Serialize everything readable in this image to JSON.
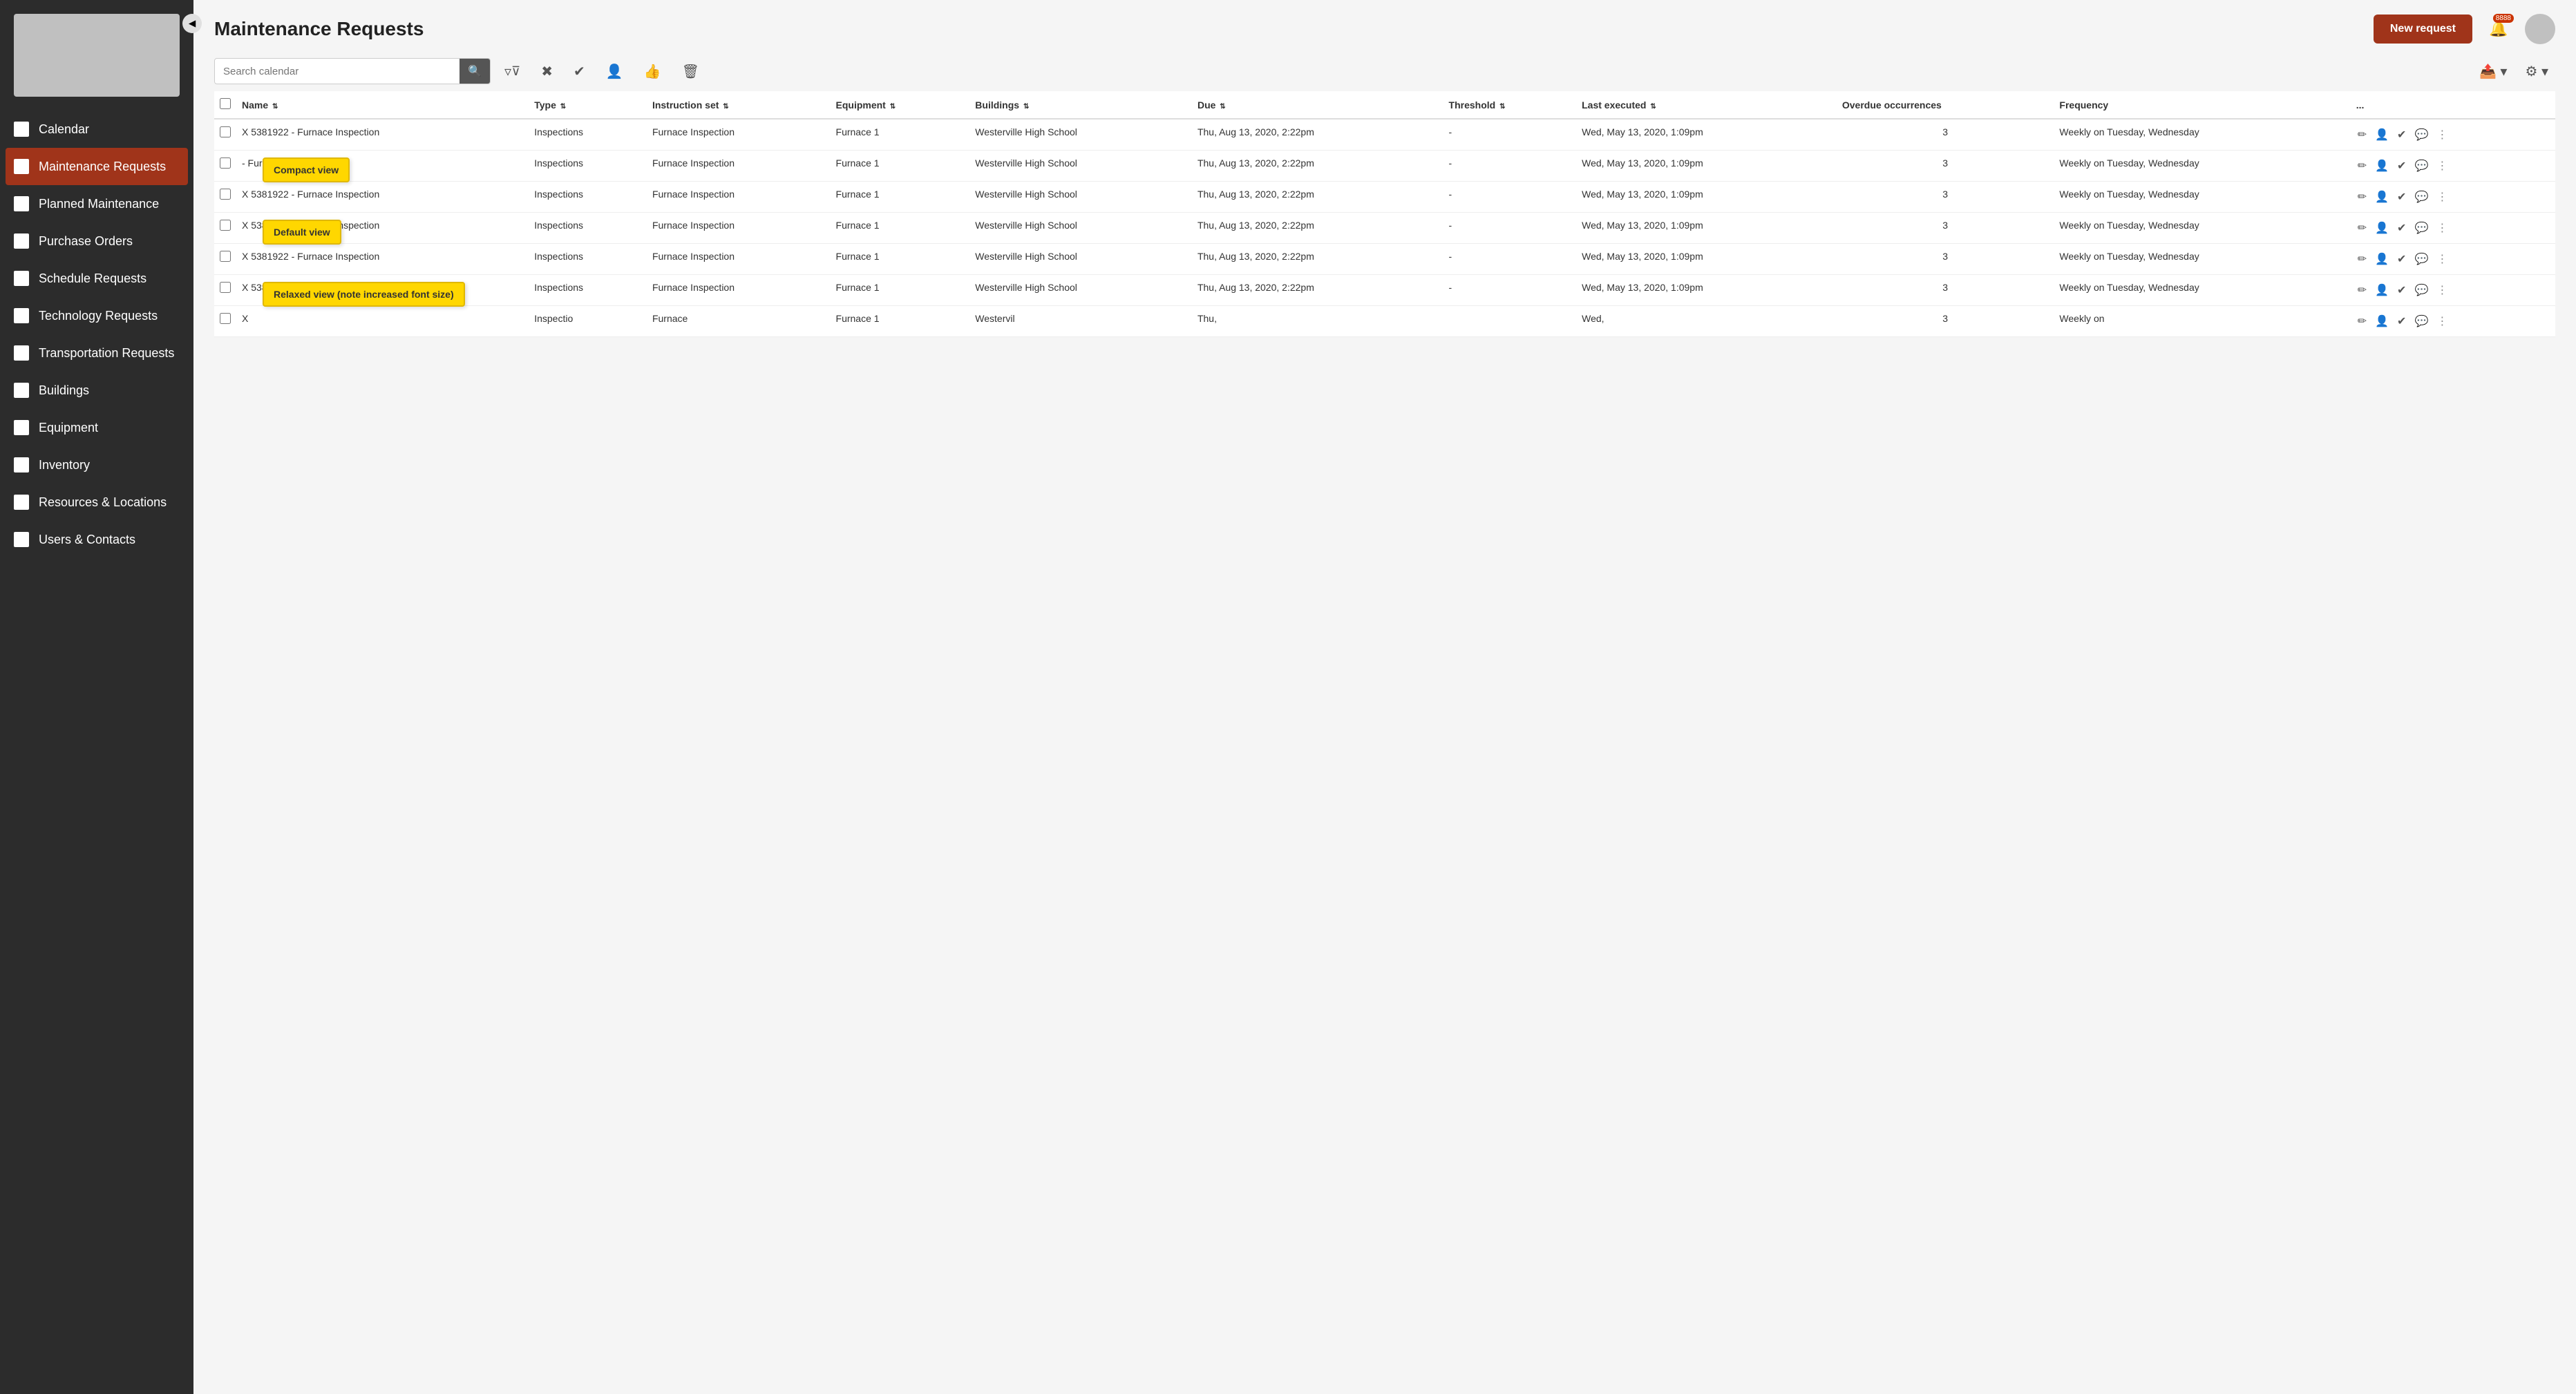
{
  "app": {
    "title": "Maintenance Requests",
    "new_request_label": "New request",
    "notification_count": "8888"
  },
  "sidebar": {
    "items": [
      {
        "id": "calendar",
        "label": "Calendar",
        "active": false
      },
      {
        "id": "maintenance-requests",
        "label": "Maintenance Requests",
        "active": true
      },
      {
        "id": "planned-maintenance",
        "label": "Planned Maintenance",
        "active": false
      },
      {
        "id": "purchase-orders",
        "label": "Purchase Orders",
        "active": false
      },
      {
        "id": "schedule-requests",
        "label": "Schedule Requests",
        "active": false
      },
      {
        "id": "technology-requests",
        "label": "Technology Requests",
        "active": false
      },
      {
        "id": "transportation-requests",
        "label": "Transportation Requests",
        "active": false
      },
      {
        "id": "buildings",
        "label": "Buildings",
        "active": false
      },
      {
        "id": "equipment",
        "label": "Equipment",
        "active": false
      },
      {
        "id": "inventory",
        "label": "Inventory",
        "active": false
      },
      {
        "id": "resources-locations",
        "label": "Resources & Locations",
        "active": false
      },
      {
        "id": "users-contacts",
        "label": "Users & Contacts",
        "active": false
      }
    ]
  },
  "toolbar": {
    "search_placeholder": "Search calendar"
  },
  "table": {
    "columns": [
      {
        "id": "name",
        "label": "Name"
      },
      {
        "id": "type",
        "label": "Type"
      },
      {
        "id": "instruction-set",
        "label": "Instruction set"
      },
      {
        "id": "equipment",
        "label": "Equipment"
      },
      {
        "id": "buildings",
        "label": "Buildings"
      },
      {
        "id": "due",
        "label": "Due"
      },
      {
        "id": "threshold",
        "label": "Threshold"
      },
      {
        "id": "last-executed",
        "label": "Last executed"
      },
      {
        "id": "overdue-occurrences",
        "label": "Overdue occurrences"
      },
      {
        "id": "frequency",
        "label": "Frequency"
      },
      {
        "id": "more",
        "label": "..."
      }
    ],
    "rows": [
      {
        "name": "X 5381922 - Furnace Inspection",
        "type": "Inspections",
        "instruction_set": "Furnace Inspection",
        "equipment": "Furnace 1",
        "buildings": "Westerville High School",
        "due": "Thu, Aug 13, 2020, 2:22pm",
        "threshold": "-",
        "last_executed": "Wed, May 13, 2020, 1:09pm",
        "overdue_occurrences": "3",
        "frequency": "Weekly on Tuesday, Wednesday",
        "tooltip": null
      },
      {
        "name": "- Furnace Inspection",
        "type": "Inspections",
        "instruction_set": "Furnace Inspection",
        "equipment": "Furnace 1",
        "buildings": "Westerville High School",
        "due": "Thu, Aug 13, 2020, 2:22pm",
        "threshold": "-",
        "last_executed": "Wed, May 13, 2020, 1:09pm",
        "overdue_occurrences": "3",
        "frequency": "Weekly on Tuesday, Wednesday",
        "tooltip": "Compact view"
      },
      {
        "name": "X 5381922 - Furnace Inspection",
        "type": "Inspections",
        "instruction_set": "Furnace Inspection",
        "equipment": "Furnace 1",
        "buildings": "Westerville High School",
        "due": "Thu, Aug 13, 2020, 2:22pm",
        "threshold": "-",
        "last_executed": "Wed, May 13, 2020, 1:09pm",
        "overdue_occurrences": "3",
        "frequency": "Weekly on Tuesday, Wednesday",
        "tooltip": null
      },
      {
        "name": "X 5381922 - Furnace Inspection",
        "type": "Inspections",
        "instruction_set": "Furnace Inspection",
        "equipment": "Furnace 1",
        "buildings": "Westerville High School",
        "due": "Thu, Aug 13, 2020, 2:22pm",
        "threshold": "-",
        "last_executed": "Wed, May 13, 2020, 1:09pm",
        "overdue_occurrences": "3",
        "frequency": "Weekly on Tuesday, Wednesday",
        "tooltip": "Default view"
      },
      {
        "name": "X 5381922 - Furnace Inspection",
        "type": "Inspections",
        "instruction_set": "Furnace Inspection",
        "equipment": "Furnace 1",
        "buildings": "Westerville High School",
        "due": "Thu, Aug 13, 2020, 2:22pm",
        "threshold": "-",
        "last_executed": "Wed, May 13, 2020, 1:09pm",
        "overdue_occurrences": "3",
        "frequency": "Weekly on Tuesday, Wednesday",
        "tooltip": null
      },
      {
        "name": "X 5381922 -",
        "type": "Inspections",
        "instruction_set": "Furnace Inspection",
        "equipment": "Furnace 1",
        "buildings": "Westerville High School",
        "due": "Thu, Aug 13, 2020, 2:22pm",
        "threshold": "-",
        "last_executed": "Wed, May 13, 2020, 1:09pm",
        "overdue_occurrences": "3",
        "frequency": "Weekly on Tuesday, Wednesday",
        "tooltip": "Relaxed view (note increased font size)"
      },
      {
        "name": "X",
        "type": "Inspectio",
        "instruction_set": "Furnace",
        "equipment": "Furnace 1",
        "buildings": "Westervil",
        "due": "Thu,",
        "threshold": "",
        "last_executed": "Wed,",
        "overdue_occurrences": "3",
        "frequency": "Weekly on",
        "tooltip": null
      }
    ]
  }
}
